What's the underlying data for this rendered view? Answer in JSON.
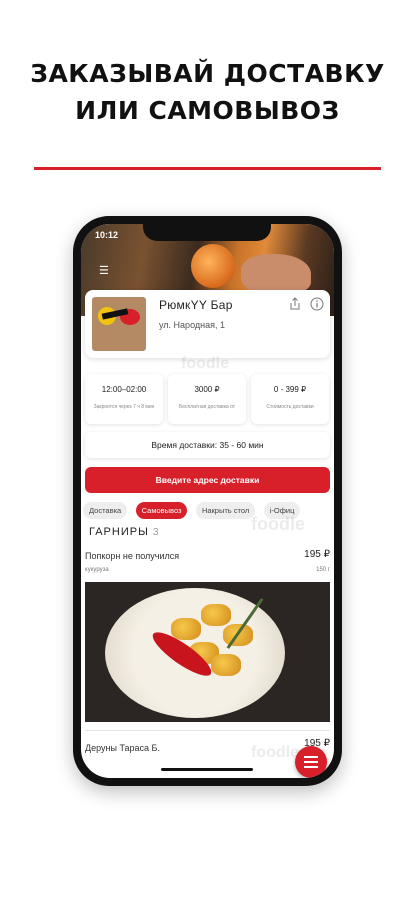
{
  "headline": {
    "line1": "ЗАКАЗЫВАЙ ДОСТАВКУ",
    "line2": "ИЛИ САМОВЫВОЗ"
  },
  "status_bar": {
    "time": "10:12"
  },
  "restaurant": {
    "name": "РюмкYY Бар",
    "address": "ул. Народная, 1",
    "watermark": "foodle"
  },
  "stats": [
    {
      "value": "12:00–02:00",
      "label": "Закроется через 7 ч 8 мин"
    },
    {
      "value": "3000 ₽",
      "label": "Бесплатная доставка от"
    },
    {
      "value": "0 - 399 ₽",
      "label": "Стоимость доставки"
    }
  ],
  "delivery_time": "Время доставки: 35 - 60 мин",
  "address_button": "Введите адрес доставки",
  "tabs": [
    "Доставка",
    "Самовывоз",
    "Накрыть стол",
    "i-Офиц"
  ],
  "active_tab": "Самовывоз",
  "section": {
    "title": "ГАРНИРЫ",
    "count": "3"
  },
  "items": [
    {
      "name": "Попкорн не получился",
      "price": "195 ₽",
      "category": "кукуруза",
      "weight": "150 г"
    },
    {
      "name": "Деруны Тараса Б.",
      "price": "195 ₽"
    }
  ],
  "colors": {
    "accent": "#d7202a"
  },
  "icons": {
    "share": "share-icon",
    "info": "info-icon",
    "menu": "hamburger-menu-icon",
    "fab": "hamburger-menu-icon"
  }
}
